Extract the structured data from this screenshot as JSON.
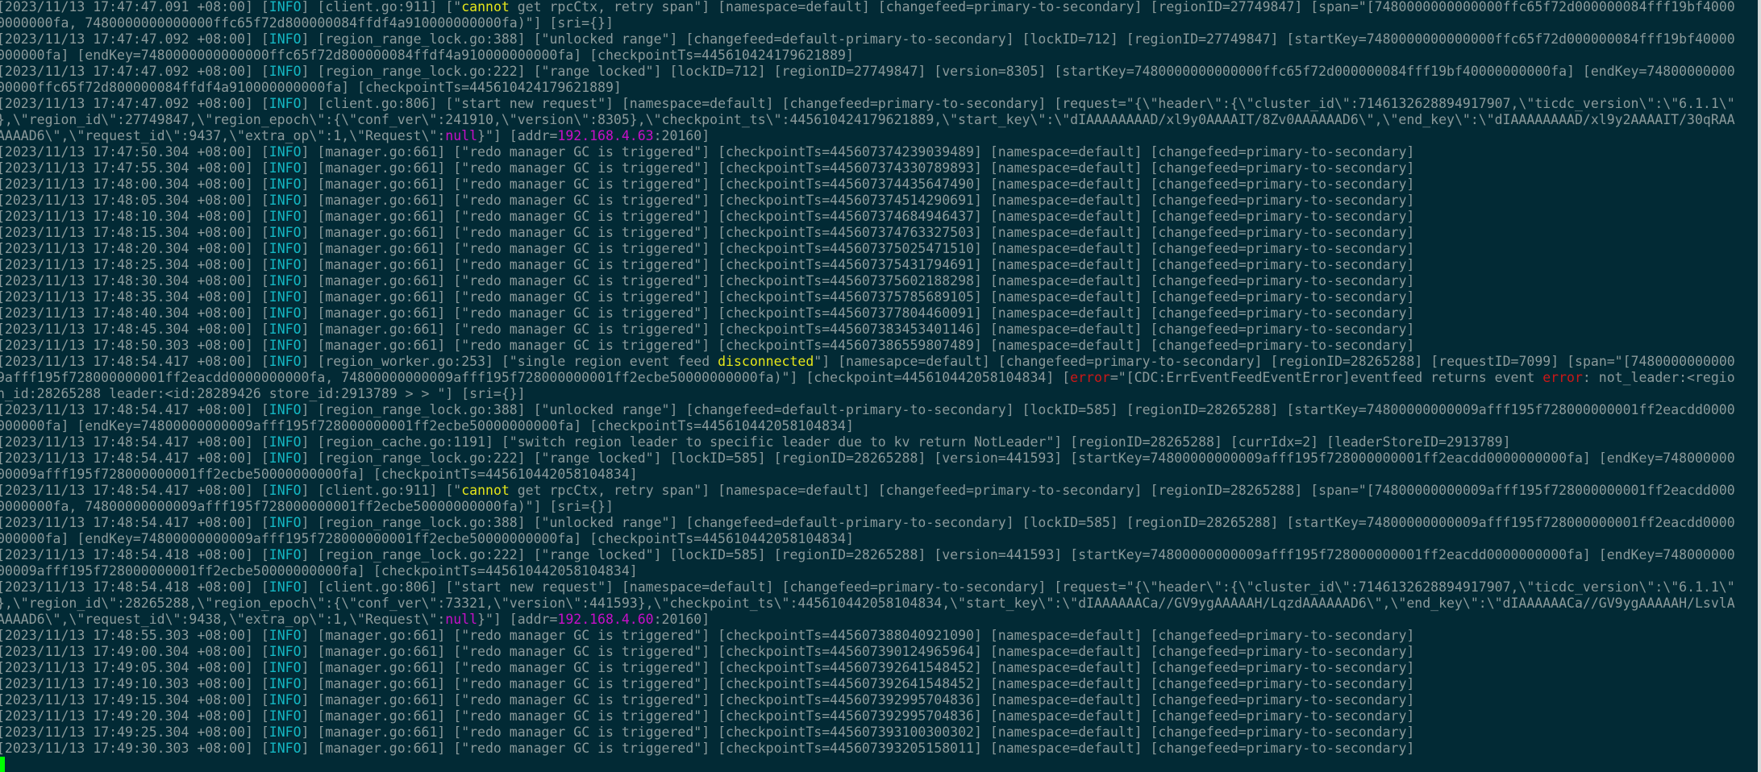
{
  "colors": {
    "background": "#022a35",
    "text": "#8b9a9b",
    "info": "#14b8c4",
    "highlight": "#e6e61a",
    "error": "#cc1818",
    "literal": "#c90fc9",
    "cursor": "#00ff00"
  },
  "rows": [
    [
      "[2023/11/13 17:47:47.091 +08:00] [",
      {
        "c": "i",
        "t": "INFO"
      },
      "] [client.go:911] [\"",
      {
        "c": "y",
        "t": "cannot"
      },
      " get rpcCtx, retry span\"] [namespace=default] [changefeed=primary-to-secondary] [regionID=27749847] [span=\"[7480000000000000ffc65f72d000000084fff19bf4000"
    ],
    [
      "0000000fa, 7480000000000000ffc65f72d800000084ffdf4a910000000000fa)\"] [sri={}]"
    ],
    [
      "[2023/11/13 17:47:47.092 +08:00] [",
      {
        "c": "i",
        "t": "INFO"
      },
      "] [region_range_lock.go:388] [\"unlocked range\"] [changefeed=default-primary-to-secondary] [lockID=712] [regionID=27749847] [startKey=7480000000000000ffc65f72d000000084fff19bf40000"
    ],
    [
      "000000fa] [endKey=7480000000000000ffc65f72d800000084ffdf4a910000000000fa] [checkpointTs=445610424179621889]"
    ],
    [
      "[2023/11/13 17:47:47.092 +08:00] [",
      {
        "c": "i",
        "t": "INFO"
      },
      "] [region_range_lock.go:222] [\"range locked\"] [lockID=712] [regionID=27749847] [version=8305] [startKey=7480000000000000ffc65f72d000000084fff19bf40000000000fa] [endKey=74800000000"
    ],
    [
      "00000ffc65f72d800000084ffdf4a910000000000fa] [checkpointTs=445610424179621889]"
    ],
    [
      "[2023/11/13 17:47:47.092 +08:00] [",
      {
        "c": "i",
        "t": "INFO"
      },
      "] [client.go:806] [\"start new request\"] [namespace=default] [changefeed=primary-to-secondary] [request=\"{\\\"header\\\":{\\\"cluster_id\\\":7146132628894917907,\\\"ticdc_version\\\":\\\"6.1.1\\\""
    ],
    [
      "},\\\"region_id\\\":27749847,\\\"region_epoch\\\":{\\\"conf_ver\\\":241910,\\\"version\\\":8305},\\\"checkpoint_ts\\\":445610424179621889,\\\"start_key\\\":\\\"dIAAAAAAAAD/xl9y0AAAAIT/8Zv0AAAAAAD6\\\",\\\"end_key\\\":\\\"dIAAAAAAAAD/xl9y2AAAAIT/30qRAA"
    ],
    [
      "AAAAD6\\\",\\\"request_id\\\":9437,\\\"extra_op\\\":1,\\\"Request\\\":",
      {
        "c": "m",
        "t": "null"
      },
      "}\"] [addr=",
      {
        "c": "m",
        "t": "192.168.4.63"
      },
      ":20160]"
    ],
    [
      "[2023/11/13 17:47:50.304 +08:00] [",
      {
        "c": "i",
        "t": "INFO"
      },
      "] [manager.go:661] [\"redo manager GC is triggered\"] [checkpointTs=445607374239039489] [namespace=default] [changefeed=primary-to-secondary]"
    ],
    [
      "[2023/11/13 17:47:55.304 +08:00] [",
      {
        "c": "i",
        "t": "INFO"
      },
      "] [manager.go:661] [\"redo manager GC is triggered\"] [checkpointTs=445607374330789893] [namespace=default] [changefeed=primary-to-secondary]"
    ],
    [
      "[2023/11/13 17:48:00.304 +08:00] [",
      {
        "c": "i",
        "t": "INFO"
      },
      "] [manager.go:661] [\"redo manager GC is triggered\"] [checkpointTs=445607374435647490] [namespace=default] [changefeed=primary-to-secondary]"
    ],
    [
      "[2023/11/13 17:48:05.304 +08:00] [",
      {
        "c": "i",
        "t": "INFO"
      },
      "] [manager.go:661] [\"redo manager GC is triggered\"] [checkpointTs=445607374514290691] [namespace=default] [changefeed=primary-to-secondary]"
    ],
    [
      "[2023/11/13 17:48:10.304 +08:00] [",
      {
        "c": "i",
        "t": "INFO"
      },
      "] [manager.go:661] [\"redo manager GC is triggered\"] [checkpointTs=445607374684946437] [namespace=default] [changefeed=primary-to-secondary]"
    ],
    [
      "[2023/11/13 17:48:15.304 +08:00] [",
      {
        "c": "i",
        "t": "INFO"
      },
      "] [manager.go:661] [\"redo manager GC is triggered\"] [checkpointTs=445607374763327503] [namespace=default] [changefeed=primary-to-secondary]"
    ],
    [
      "[2023/11/13 17:48:20.304 +08:00] [",
      {
        "c": "i",
        "t": "INFO"
      },
      "] [manager.go:661] [\"redo manager GC is triggered\"] [checkpointTs=445607375025471510] [namespace=default] [changefeed=primary-to-secondary]"
    ],
    [
      "[2023/11/13 17:48:25.304 +08:00] [",
      {
        "c": "i",
        "t": "INFO"
      },
      "] [manager.go:661] [\"redo manager GC is triggered\"] [checkpointTs=445607375431794691] [namespace=default] [changefeed=primary-to-secondary]"
    ],
    [
      "[2023/11/13 17:48:30.304 +08:00] [",
      {
        "c": "i",
        "t": "INFO"
      },
      "] [manager.go:661] [\"redo manager GC is triggered\"] [checkpointTs=445607375602188298] [namespace=default] [changefeed=primary-to-secondary]"
    ],
    [
      "[2023/11/13 17:48:35.304 +08:00] [",
      {
        "c": "i",
        "t": "INFO"
      },
      "] [manager.go:661] [\"redo manager GC is triggered\"] [checkpointTs=445607375785689105] [namespace=default] [changefeed=primary-to-secondary]"
    ],
    [
      "[2023/11/13 17:48:40.304 +08:00] [",
      {
        "c": "i",
        "t": "INFO"
      },
      "] [manager.go:661] [\"redo manager GC is triggered\"] [checkpointTs=445607377804460091] [namespace=default] [changefeed=primary-to-secondary]"
    ],
    [
      "[2023/11/13 17:48:45.304 +08:00] [",
      {
        "c": "i",
        "t": "INFO"
      },
      "] [manager.go:661] [\"redo manager GC is triggered\"] [checkpointTs=445607383453401146] [namespace=default] [changefeed=primary-to-secondary]"
    ],
    [
      "[2023/11/13 17:48:50.303 +08:00] [",
      {
        "c": "i",
        "t": "INFO"
      },
      "] [manager.go:661] [\"redo manager GC is triggered\"] [checkpointTs=445607386559807489] [namespace=default] [changefeed=primary-to-secondary]"
    ],
    [
      "[2023/11/13 17:48:54.417 +08:00] [",
      {
        "c": "i",
        "t": "INFO"
      },
      "] [region_worker.go:253] [\"single region event feed ",
      {
        "c": "y",
        "t": "disconnected"
      },
      "\"] [namesapce=default] [changefeed=primary-to-secondary] [regionID=28265288] [requestID=7099] [span=\"[7480000000000"
    ],
    [
      "9afff195f728000000001ff2eacdd0000000000fa, 74800000000009afff195f728000000001ff2ecbe50000000000fa)\"] [checkpoint=445610442058104834] [",
      {
        "c": "r",
        "t": "error"
      },
      "=\"[CDC:ErrEventFeedEventError]eventfeed returns event ",
      {
        "c": "r",
        "t": "error"
      },
      ": not_leader:<regio"
    ],
    [
      "n_id:28265288 leader:<id:28289426 store_id:2913789 > > \"] [sri={}]"
    ],
    [
      "[2023/11/13 17:48:54.417 +08:00] [",
      {
        "c": "i",
        "t": "INFO"
      },
      "] [region_range_lock.go:388] [\"unlocked range\"] [changefeed=default-primary-to-secondary] [lockID=585] [regionID=28265288] [startKey=74800000000009afff195f728000000001ff2eacdd0000"
    ],
    [
      "000000fa] [endKey=74800000000009afff195f728000000001ff2ecbe50000000000fa] [checkpointTs=445610442058104834]"
    ],
    [
      "[2023/11/13 17:48:54.417 +08:00] [",
      {
        "c": "i",
        "t": "INFO"
      },
      "] [region_cache.go:1191] [\"switch region leader to specific leader due to kv return NotLeader\"] [regionID=28265288] [currIdx=2] [leaderStoreID=2913789]"
    ],
    [
      "[2023/11/13 17:48:54.417 +08:00] [",
      {
        "c": "i",
        "t": "INFO"
      },
      "] [region_range_lock.go:222] [\"range locked\"] [lockID=585] [regionID=28265288] [version=441593] [startKey=74800000000009afff195f728000000001ff2eacdd0000000000fa] [endKey=748000000"
    ],
    [
      "00009afff195f728000000001ff2ecbe50000000000fa] [checkpointTs=445610442058104834]"
    ],
    [
      "[2023/11/13 17:48:54.417 +08:00] [",
      {
        "c": "i",
        "t": "INFO"
      },
      "] [client.go:911] [\"",
      {
        "c": "y",
        "t": "cannot"
      },
      " get rpcCtx, retry span\"] [namespace=default] [changefeed=primary-to-secondary] [regionID=28265288] [span=\"[74800000000009afff195f728000000001ff2eacdd000"
    ],
    [
      "0000000fa, 74800000000009afff195f728000000001ff2ecbe50000000000fa)\"] [sri={}]"
    ],
    [
      "[2023/11/13 17:48:54.417 +08:00] [",
      {
        "c": "i",
        "t": "INFO"
      },
      "] [region_range_lock.go:388] [\"unlocked range\"] [changefeed=default-primary-to-secondary] [lockID=585] [regionID=28265288] [startKey=74800000000009afff195f728000000001ff2eacdd0000"
    ],
    [
      "000000fa] [endKey=74800000000009afff195f728000000001ff2ecbe50000000000fa] [checkpointTs=445610442058104834]"
    ],
    [
      "[2023/11/13 17:48:54.418 +08:00] [",
      {
        "c": "i",
        "t": "INFO"
      },
      "] [region_range_lock.go:222] [\"range locked\"] [lockID=585] [regionID=28265288] [version=441593] [startKey=74800000000009afff195f728000000001ff2eacdd0000000000fa] [endKey=748000000"
    ],
    [
      "00009afff195f728000000001ff2ecbe50000000000fa] [checkpointTs=445610442058104834]"
    ],
    [
      "[2023/11/13 17:48:54.418 +08:00] [",
      {
        "c": "i",
        "t": "INFO"
      },
      "] [client.go:806] [\"start new request\"] [namespace=default] [changefeed=primary-to-secondary] [request=\"{\\\"header\\\":{\\\"cluster_id\\\":7146132628894917907,\\\"ticdc_version\\\":\\\"6.1.1\\\""
    ],
    [
      "},\\\"region_id\\\":28265288,\\\"region_epoch\\\":{\\\"conf_ver\\\":73321,\\\"version\\\":441593},\\\"checkpoint_ts\\\":445610442058104834,\\\"start_key\\\":\\\"dIAAAAAACa//GV9ygAAAAAH/LqzdAAAAAAD6\\\",\\\"end_key\\\":\\\"dIAAAAAACa//GV9ygAAAAAH/LsvlA"
    ],
    [
      "AAAAD6\\\",\\\"request_id\\\":9438,\\\"extra_op\\\":1,\\\"Request\\\":",
      {
        "c": "m",
        "t": "null"
      },
      "}\"] [addr=",
      {
        "c": "m",
        "t": "192.168.4.60"
      },
      ":20160]"
    ],
    [
      "[2023/11/13 17:48:55.303 +08:00] [",
      {
        "c": "i",
        "t": "INFO"
      },
      "] [manager.go:661] [\"redo manager GC is triggered\"] [checkpointTs=445607388040921090] [namespace=default] [changefeed=primary-to-secondary]"
    ],
    [
      "[2023/11/13 17:49:00.304 +08:00] [",
      {
        "c": "i",
        "t": "INFO"
      },
      "] [manager.go:661] [\"redo manager GC is triggered\"] [checkpointTs=445607390124965964] [namespace=default] [changefeed=primary-to-secondary]"
    ],
    [
      "[2023/11/13 17:49:05.304 +08:00] [",
      {
        "c": "i",
        "t": "INFO"
      },
      "] [manager.go:661] [\"redo manager GC is triggered\"] [checkpointTs=445607392641548452] [namespace=default] [changefeed=primary-to-secondary]"
    ],
    [
      "[2023/11/13 17:49:10.303 +08:00] [",
      {
        "c": "i",
        "t": "INFO"
      },
      "] [manager.go:661] [\"redo manager GC is triggered\"] [checkpointTs=445607392641548452] [namespace=default] [changefeed=primary-to-secondary]"
    ],
    [
      "[2023/11/13 17:49:15.304 +08:00] [",
      {
        "c": "i",
        "t": "INFO"
      },
      "] [manager.go:661] [\"redo manager GC is triggered\"] [checkpointTs=445607392995704836] [namespace=default] [changefeed=primary-to-secondary]"
    ],
    [
      "[2023/11/13 17:49:20.304 +08:00] [",
      {
        "c": "i",
        "t": "INFO"
      },
      "] [manager.go:661] [\"redo manager GC is triggered\"] [checkpointTs=445607392995704836] [namespace=default] [changefeed=primary-to-secondary]"
    ],
    [
      "[2023/11/13 17:49:25.304 +08:00] [",
      {
        "c": "i",
        "t": "INFO"
      },
      "] [manager.go:661] [\"redo manager GC is triggered\"] [checkpointTs=445607393100300302] [namespace=default] [changefeed=primary-to-secondary]"
    ],
    [
      "[2023/11/13 17:49:30.303 +08:00] [",
      {
        "c": "i",
        "t": "INFO"
      },
      "] [manager.go:661] [\"redo manager GC is triggered\"] [checkpointTs=445607393205158011] [namespace=default] [changefeed=primary-to-secondary]"
    ]
  ]
}
